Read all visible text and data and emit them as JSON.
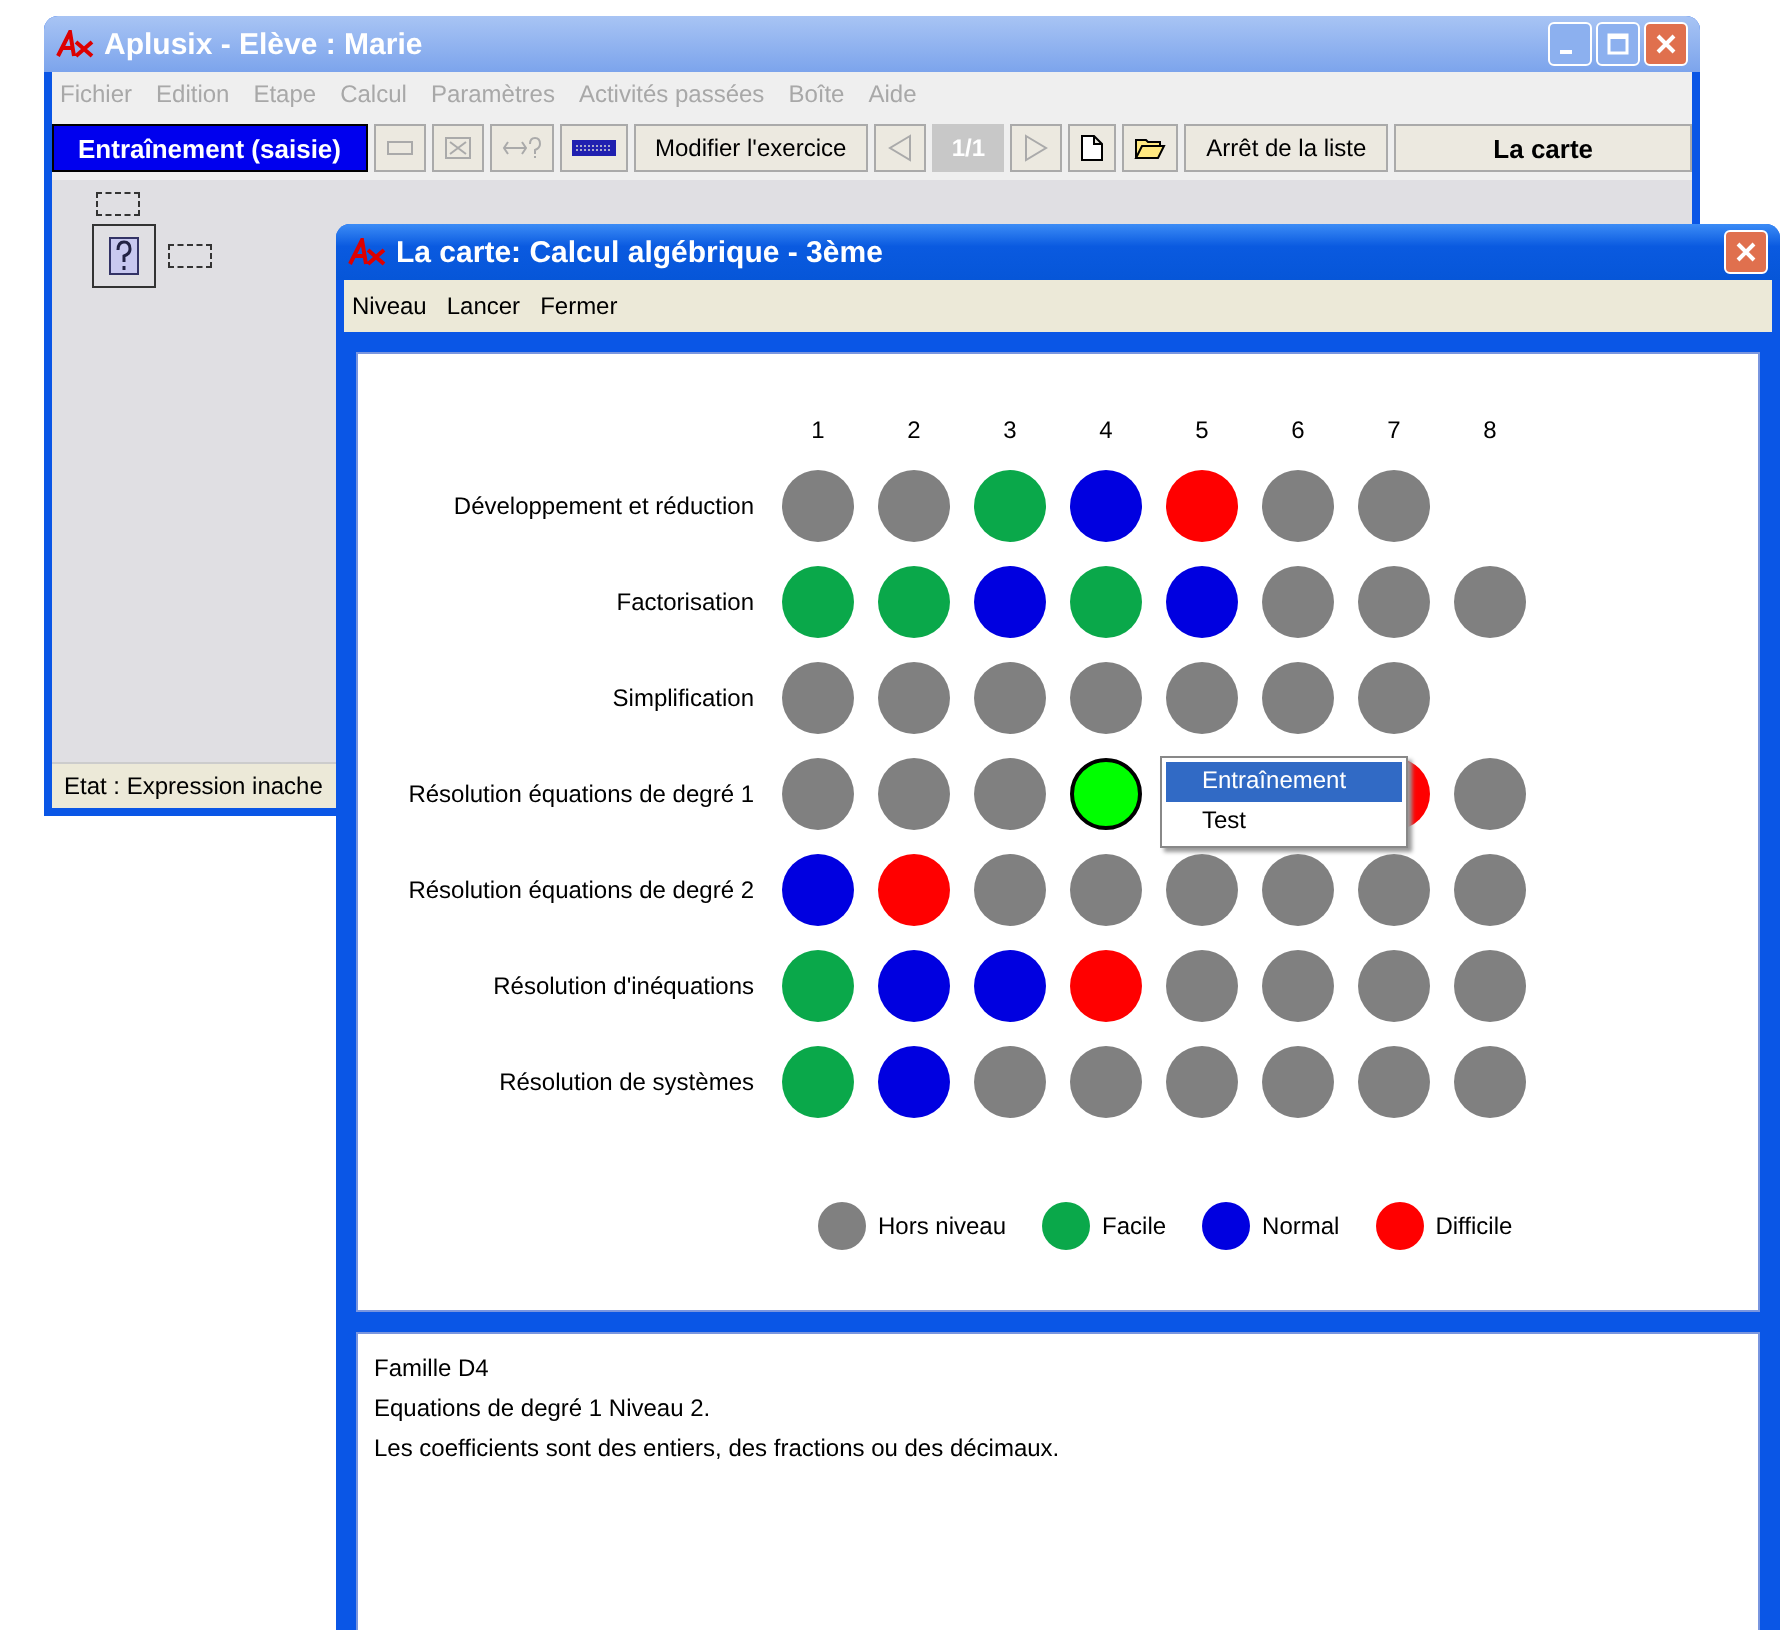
{
  "back_window": {
    "title": "Aplusix - Elève : Marie",
    "menu": [
      {
        "label": "Fichier",
        "disabled": true
      },
      {
        "label": "Edition",
        "disabled": true
      },
      {
        "label": "Etape",
        "disabled": true
      },
      {
        "label": "Calcul",
        "disabled": true
      },
      {
        "label": "Paramètres",
        "disabled": true
      },
      {
        "label": "Activités passées",
        "disabled": true
      },
      {
        "label": "Boîte",
        "disabled": true
      },
      {
        "label": "Aide",
        "disabled": true
      }
    ],
    "toolbar": {
      "mode_button": "Entraînement (saisie)",
      "tools": [
        {
          "disabled": true
        },
        {
          "disabled": true
        },
        {
          "disabled": true
        },
        {
          "disabled": false
        }
      ],
      "edit_button": "Modifier l'exercice",
      "prev": {
        "disabled": true
      },
      "counter": {
        "text": "1/1",
        "disabled": true
      },
      "next": {
        "disabled": true
      },
      "file_tools": [
        {
          "disabled": false
        },
        {
          "disabled": false
        }
      ],
      "stop_button": "Arrêt de la liste",
      "map_button": "La carte"
    },
    "status": "Etat : Expression inache"
  },
  "map_window": {
    "title": "La carte: Calcul algébrique - 3ème",
    "menu": [
      "Niveau",
      "Lancer",
      "Fermer"
    ],
    "columns": [
      "1",
      "2",
      "3",
      "4",
      "5",
      "6",
      "7",
      "8"
    ],
    "rows": [
      {
        "label": "Développement et réduction",
        "cells": [
          {
            "color": "#808080",
            "selected": false
          },
          {
            "color": "#808080",
            "selected": false
          },
          {
            "color": "#0aa84a",
            "selected": false
          },
          {
            "color": "#0000e0",
            "selected": false
          },
          {
            "color": "#ff0000",
            "selected": false
          },
          {
            "color": "#808080",
            "selected": false
          },
          {
            "color": "#808080",
            "selected": false
          }
        ]
      },
      {
        "label": "Factorisation",
        "cells": [
          {
            "color": "#0aa84a",
            "selected": false
          },
          {
            "color": "#0aa84a",
            "selected": false
          },
          {
            "color": "#0000e0",
            "selected": false
          },
          {
            "color": "#0aa84a",
            "selected": false
          },
          {
            "color": "#0000e0",
            "selected": false
          },
          {
            "color": "#808080",
            "selected": false
          },
          {
            "color": "#808080",
            "selected": false
          },
          {
            "color": "#808080",
            "selected": false
          }
        ]
      },
      {
        "label": "Simplification",
        "cells": [
          {
            "color": "#808080",
            "selected": false
          },
          {
            "color": "#808080",
            "selected": false
          },
          {
            "color": "#808080",
            "selected": false
          },
          {
            "color": "#808080",
            "selected": false
          },
          {
            "color": "#808080",
            "selected": false
          },
          {
            "color": "#808080",
            "selected": false
          },
          {
            "color": "#808080",
            "selected": false
          }
        ]
      },
      {
        "label": "Résolution équations de degré 1",
        "cells": [
          {
            "color": "#808080",
            "selected": false
          },
          {
            "color": "#808080",
            "selected": false
          },
          {
            "color": "#808080",
            "selected": false
          },
          {
            "color": "#00ff00",
            "selected": true
          },
          null,
          null,
          {
            "color": "#ff0000",
            "selected": false
          },
          {
            "color": "#808080",
            "selected": false
          }
        ]
      },
      {
        "label": "Résolution équations de degré 2",
        "cells": [
          {
            "color": "#0000e0",
            "selected": false
          },
          {
            "color": "#ff0000",
            "selected": false
          },
          {
            "color": "#808080",
            "selected": false
          },
          {
            "color": "#808080",
            "selected": false
          },
          {
            "color": "#808080",
            "selected": false
          },
          {
            "color": "#808080",
            "selected": false
          },
          {
            "color": "#808080",
            "selected": false
          },
          {
            "color": "#808080",
            "selected": false
          }
        ]
      },
      {
        "label": "Résolution d'inéquations",
        "cells": [
          {
            "color": "#0aa84a",
            "selected": false
          },
          {
            "color": "#0000e0",
            "selected": false
          },
          {
            "color": "#0000e0",
            "selected": false
          },
          {
            "color": "#ff0000",
            "selected": false
          },
          {
            "color": "#808080",
            "selected": false
          },
          {
            "color": "#808080",
            "selected": false
          },
          {
            "color": "#808080",
            "selected": false
          },
          {
            "color": "#808080",
            "selected": false
          }
        ]
      },
      {
        "label": "Résolution de systèmes",
        "cells": [
          {
            "color": "#0aa84a",
            "selected": false
          },
          {
            "color": "#0000e0",
            "selected": false
          },
          {
            "color": "#808080",
            "selected": false
          },
          {
            "color": "#808080",
            "selected": false
          },
          {
            "color": "#808080",
            "selected": false
          },
          {
            "color": "#808080",
            "selected": false
          },
          {
            "color": "#808080",
            "selected": false
          },
          {
            "color": "#808080",
            "selected": false
          }
        ]
      }
    ],
    "legend": [
      {
        "label": "Hors niveau",
        "color": "#808080"
      },
      {
        "label": "Facile",
        "color": "#0aa84a"
      },
      {
        "label": "Normal",
        "color": "#0000e0"
      },
      {
        "label": "Difficile",
        "color": "#ff0000"
      }
    ],
    "description": [
      "Famille D4",
      "Equations de degré 1 Niveau 2.",
      "Les coefficients sont des entiers, des fractions ou des décimaux."
    ]
  },
  "context_menu": [
    {
      "label": "Entraînement",
      "selected": true
    },
    {
      "label": "Test",
      "selected": false
    }
  ]
}
